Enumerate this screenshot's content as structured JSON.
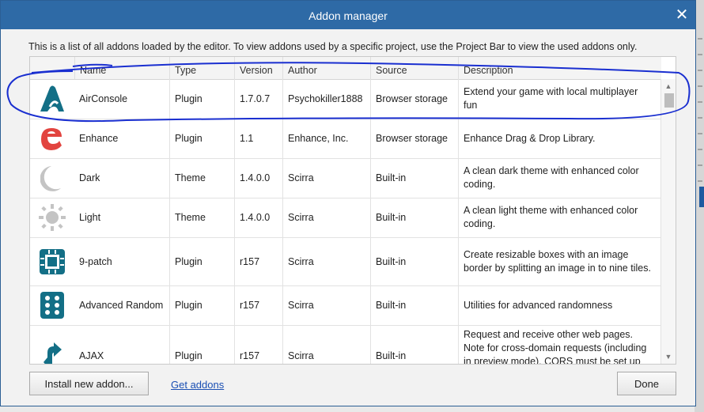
{
  "dialog": {
    "title": "Addon manager",
    "close_glyph": "✕",
    "intro": "This is a list of all addons loaded by the editor. To view addons used by a specific project, use the Project Bar to view the used addons only."
  },
  "table": {
    "headers": [
      "Name",
      "Type",
      "Version",
      "Author",
      "Source",
      "Description"
    ],
    "rows": [
      {
        "icon": "airconsole-icon",
        "name": "AirConsole",
        "type": "Plugin",
        "version": "1.7.0.7",
        "author": "Psychokiller1888",
        "source": "Browser storage",
        "description": "Extend your game with local multiplayer fun"
      },
      {
        "icon": "enhance-icon",
        "name": "Enhance",
        "type": "Plugin",
        "version": "1.1",
        "author": "Enhance, Inc.",
        "source": "Browser storage",
        "description": "Enhance Drag & Drop Library."
      },
      {
        "icon": "moon-icon",
        "name": "Dark",
        "type": "Theme",
        "version": "1.4.0.0",
        "author": "Scirra",
        "source": "Built-in",
        "description": "A clean dark theme with enhanced color coding."
      },
      {
        "icon": "sun-icon",
        "name": "Light",
        "type": "Theme",
        "version": "1.4.0.0",
        "author": "Scirra",
        "source": "Built-in",
        "description": "A clean light theme with enhanced color coding."
      },
      {
        "icon": "nine-patch-icon",
        "name": "9-patch",
        "type": "Plugin",
        "version": "r157",
        "author": "Scirra",
        "source": "Built-in",
        "description": "Create resizable boxes with an image border by splitting an image in to nine tiles."
      },
      {
        "icon": "dice-icon",
        "name": "Advanced Random",
        "type": "Plugin",
        "version": "r157",
        "author": "Scirra",
        "source": "Built-in",
        "description": "Utilities for advanced randomness"
      },
      {
        "icon": "ajax-icon",
        "name": "AJAX",
        "type": "Plugin",
        "version": "r157",
        "author": "Scirra",
        "source": "Built-in",
        "description": "Request and receive other web pages. Note for cross-domain requests (including in preview mode), CORS must be set up on"
      }
    ]
  },
  "footer": {
    "install_label": "Install new addon...",
    "get_addons_label": "Get addons",
    "done_label": "Done"
  },
  "colors": {
    "titlebar": "#2e6aa6",
    "icon_teal": "#136f86",
    "enhance_red": "#e2443f",
    "link": "#1a4fb3",
    "annotation_pen": "#1a2fd0"
  }
}
